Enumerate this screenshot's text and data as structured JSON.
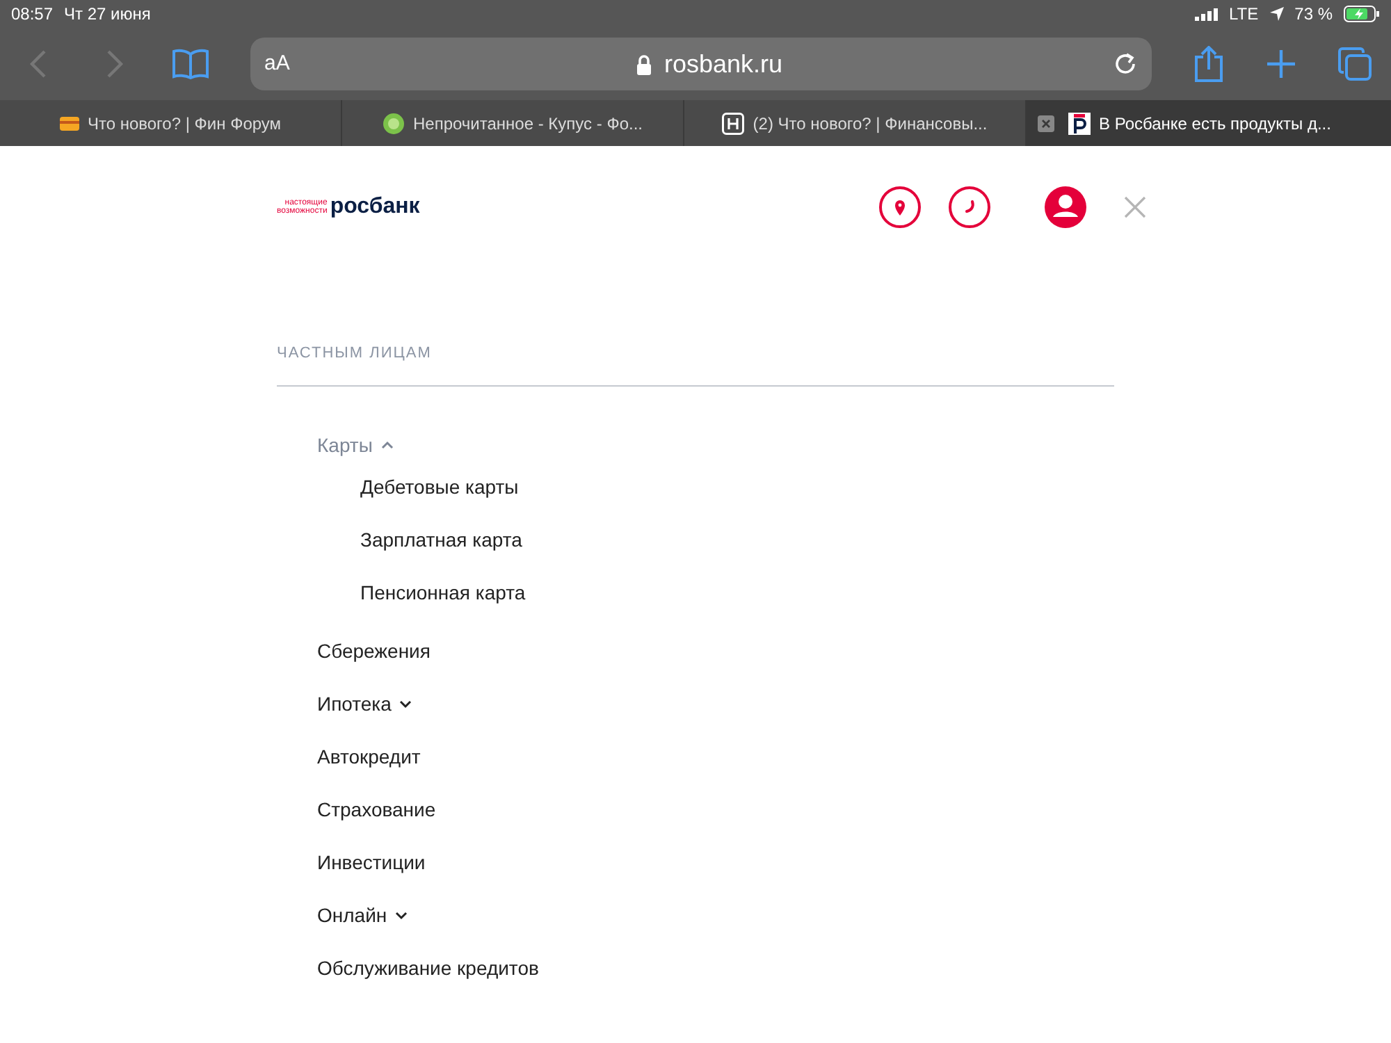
{
  "status_bar": {
    "time": "08:57",
    "date": "Чт 27 июня",
    "network": "LTE",
    "battery": "73 %"
  },
  "toolbar": {
    "text_size": "aA",
    "address": "rosbank.ru"
  },
  "tabs": [
    {
      "label": "Что нового? | Фин Форум",
      "selected": false
    },
    {
      "label": "Непрочитанное - Купус - Фо...",
      "selected": false
    },
    {
      "label": "(2) Что нового? | Финансовы...",
      "selected": false
    },
    {
      "label": "В Росбанке есть продукты д...",
      "selected": true
    }
  ],
  "page": {
    "logo": {
      "tagline_1": "настоящие",
      "tagline_2": "возможности",
      "name": "росбанк"
    },
    "section": "ЧАСТНЫМ ЛИЦАМ",
    "menu": [
      {
        "label": "Карты",
        "expanded": true,
        "children": [
          {
            "label": "Дебетовые карты"
          },
          {
            "label": "Зарплатная карта"
          },
          {
            "label": "Пенсионная карта"
          }
        ]
      },
      {
        "label": "Сбережения"
      },
      {
        "label": "Ипотека",
        "expanded": false
      },
      {
        "label": "Автокредит"
      },
      {
        "label": "Страхование"
      },
      {
        "label": "Инвестиции"
      },
      {
        "label": "Онлайн",
        "expanded": false
      },
      {
        "label": "Обслуживание кредитов"
      }
    ]
  }
}
